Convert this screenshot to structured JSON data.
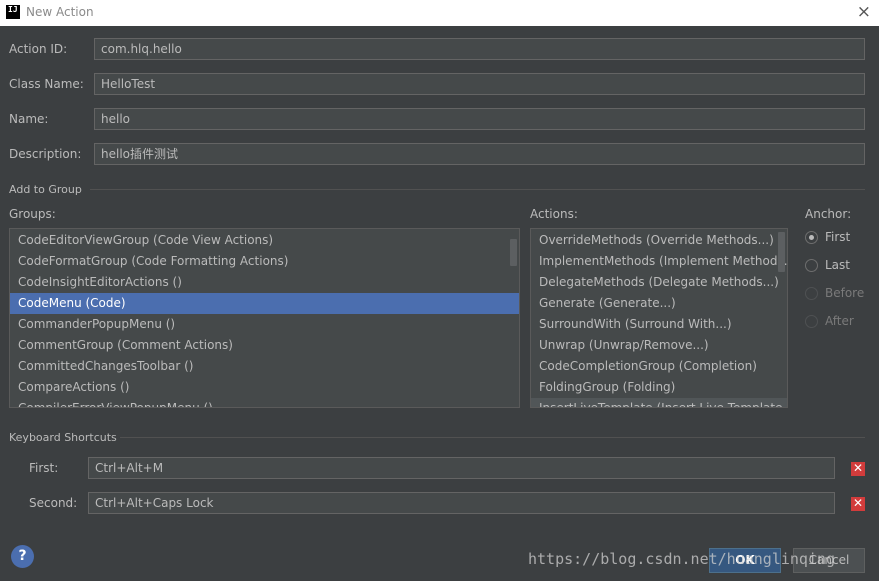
{
  "window": {
    "app_icon": "IJ",
    "title": "New Action",
    "close_glyph": "×"
  },
  "form": {
    "action_id": {
      "label": "Action ID:",
      "value": "com.hlq.hello"
    },
    "class_name": {
      "label": "Class Name:",
      "value": "HelloTest"
    },
    "name": {
      "label": "Name:",
      "value": "hello"
    },
    "description": {
      "label": "Description:",
      "value": "hello插件测试"
    }
  },
  "add_to_group": {
    "section_label": "Add to Group",
    "groups_label": "Groups:",
    "groups": [
      "CodeEditorViewGroup (Code View Actions)",
      "CodeFormatGroup (Code Formatting Actions)",
      "CodeInsightEditorActions ()",
      "CodeMenu (Code)",
      "CommanderPopupMenu ()",
      "CommentGroup (Comment Actions)",
      "CommittedChangesToolbar ()",
      "CompareActions ()",
      "CompilerErrorViewPopupMenu ()"
    ],
    "selected_group": "CodeMenu (Code)",
    "actions_label": "Actions:",
    "actions": [
      "OverrideMethods (Override Methods...)",
      "ImplementMethods (Implement Methods...)",
      "DelegateMethods (Delegate Methods...)",
      "Generate (Generate...)",
      "SurroundWith (Surround With...)",
      "Unwrap (Unwrap/Remove...)",
      "CodeCompletionGroup (Completion)",
      "FoldingGroup (Folding)",
      "InsertLiveTemplate (Insert Live Template...)"
    ],
    "anchor_label": "Anchor:",
    "anchors": [
      {
        "label": "First",
        "checked": true,
        "enabled": true
      },
      {
        "label": "Last",
        "checked": false,
        "enabled": true
      },
      {
        "label": "Before",
        "checked": false,
        "enabled": false
      },
      {
        "label": "After",
        "checked": false,
        "enabled": false
      }
    ]
  },
  "shortcuts": {
    "section_label": "Keyboard Shortcuts",
    "first": {
      "label": "First:",
      "value": "Ctrl+Alt+M"
    },
    "second": {
      "label": "Second:",
      "value": "Ctrl+Alt+Caps Lock"
    },
    "clear_glyph": "✕"
  },
  "footer": {
    "help_glyph": "?",
    "ok_label": "OK",
    "cancel_label": "Cancel",
    "watermark": "https://blog.csdn.net/huanglinqing"
  },
  "colors": {
    "background": "#3c3f41",
    "selection": "#4b6eaf",
    "field": "#45494a",
    "clear_button": "#d23c3c"
  }
}
